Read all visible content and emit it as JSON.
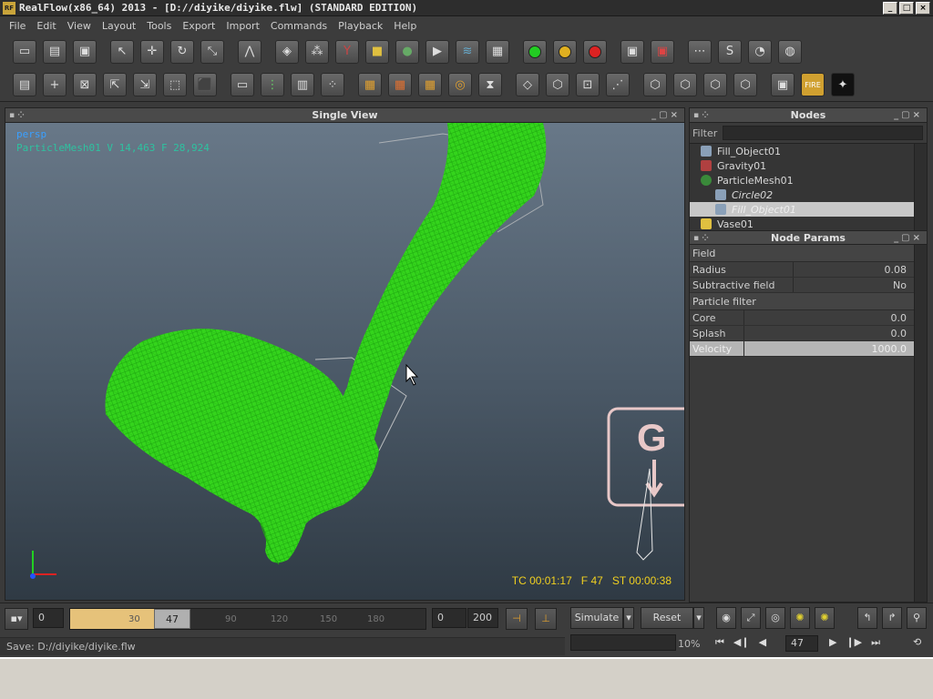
{
  "window": {
    "title": "RealFlow(x86_64) 2013 - [D://diyike/diyike.flw] (STANDARD EDITION)",
    "logo_text": "RF",
    "min": "_",
    "max": "□",
    "close": "×"
  },
  "menu": [
    "File",
    "Edit",
    "View",
    "Layout",
    "Tools",
    "Export",
    "Import",
    "Commands",
    "Playback",
    "Help"
  ],
  "viewport": {
    "panel_title": "Single View",
    "camera": "persp",
    "selection_info": "ParticleMesh01  V 14,463  F 28,924",
    "tc": "TC 00:01:17",
    "frame": "F 47",
    "st": "ST 00:00:38",
    "gravity_letter": "G"
  },
  "nodes": {
    "panel_title": "Nodes",
    "filter_label": "Filter",
    "items": [
      {
        "label": "Fill_Object01",
        "color": "#8aa0b8"
      },
      {
        "label": "Gravity01",
        "color": "#b04040"
      },
      {
        "label": "ParticleMesh01",
        "color": "#3a8a3a"
      },
      {
        "label": "Circle02",
        "color": "#8aa0b8"
      },
      {
        "label": "Fill_Object01",
        "color": "#8aa0b8"
      },
      {
        "label": "Vase01",
        "color": "#e0c040"
      }
    ]
  },
  "params": {
    "panel_title": "Node Params",
    "sections": {
      "field": "Field",
      "particle_filter": "Particle filter"
    },
    "radius": {
      "label": "Radius",
      "value": "0.08"
    },
    "subtractive": {
      "label": "Subtractive field",
      "value": "No"
    },
    "core": {
      "label": "Core",
      "value": "0.0"
    },
    "splash": {
      "label": "Splash",
      "value": "0.0"
    },
    "velocity": {
      "label": "Velocity",
      "value": "1000.0"
    }
  },
  "timeline": {
    "start": "0",
    "current": "47",
    "current_fraction": 0.235,
    "ticks": [
      "30",
      "90",
      "120",
      "150",
      "180"
    ],
    "range_start": "0",
    "range_end": "200",
    "simulate": "Simulate",
    "reset": "Reset",
    "progress": "10%",
    "frame_field": "47"
  },
  "status": "Save: D://diyike/diyike.flw",
  "colors": {
    "mesh": "#33dd22",
    "stats": "#f0d020",
    "accent": "#e6c27a"
  }
}
